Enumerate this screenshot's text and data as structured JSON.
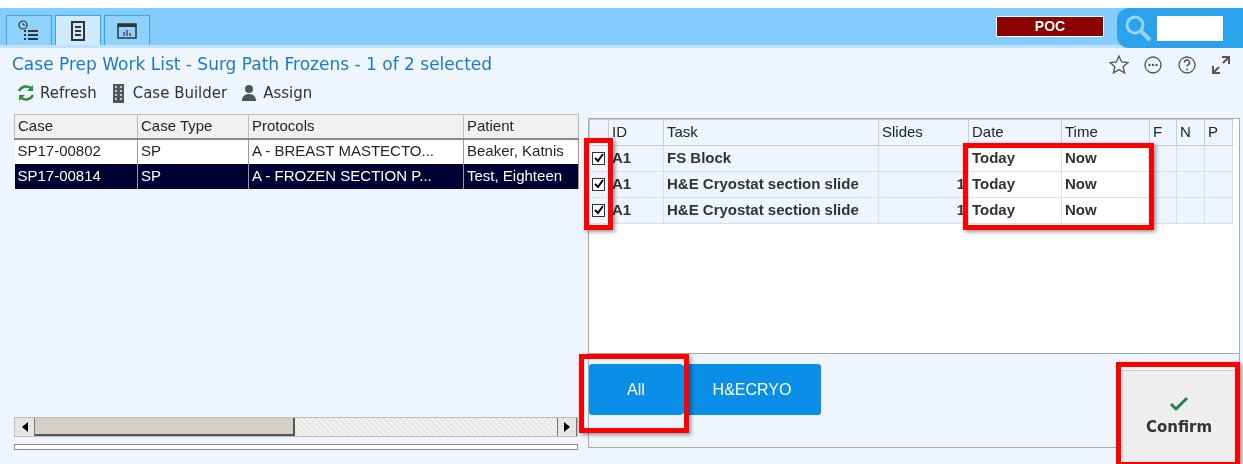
{
  "nav_tabs": [
    {
      "kind": "clock-list",
      "selected": false
    },
    {
      "kind": "document",
      "selected": true
    },
    {
      "kind": "report",
      "selected": false
    }
  ],
  "environment_badge": "POC",
  "title": "Case Prep Work List - Surg Path Frozens - 1 of 2 selected",
  "toolbar": [
    {
      "kind": "refresh",
      "label": "Refresh"
    },
    {
      "kind": "building",
      "label": "Case Builder"
    },
    {
      "kind": "person",
      "label": "Assign"
    }
  ],
  "case_table": {
    "columns": [
      "Case",
      "Case Type",
      "Protocols",
      "Patient"
    ],
    "rows": [
      {
        "selected": false,
        "cells": [
          "SP17-00802",
          "SP",
          "A - BREAST MASTECTO...",
          "Beaker, Katnis"
        ]
      },
      {
        "selected": true,
        "cells": [
          "SP17-00814",
          "SP",
          "A - FROZEN SECTION P...",
          "Test, Eighteen"
        ]
      }
    ]
  },
  "task_table": {
    "columns": [
      "ID",
      "Task",
      "Slides",
      "Date",
      "Time",
      "F",
      "N",
      "P"
    ],
    "rows": [
      {
        "checked": true,
        "id": "A1",
        "task": "FS Block",
        "date": "Today",
        "time": "Now"
      },
      {
        "checked": true,
        "id": "A1",
        "task": "H&E Cryostat section slide",
        "slides": "1",
        "date": "Today",
        "time": "Now"
      },
      {
        "checked": true,
        "id": "A1",
        "task": "H&E Cryostat section slide",
        "slides": "1",
        "date": "Today",
        "time": "Now"
      }
    ]
  },
  "filter_buttons": [
    {
      "label": "All"
    },
    {
      "label": "H&ECRYO"
    }
  ],
  "confirm_button": "Confirm"
}
